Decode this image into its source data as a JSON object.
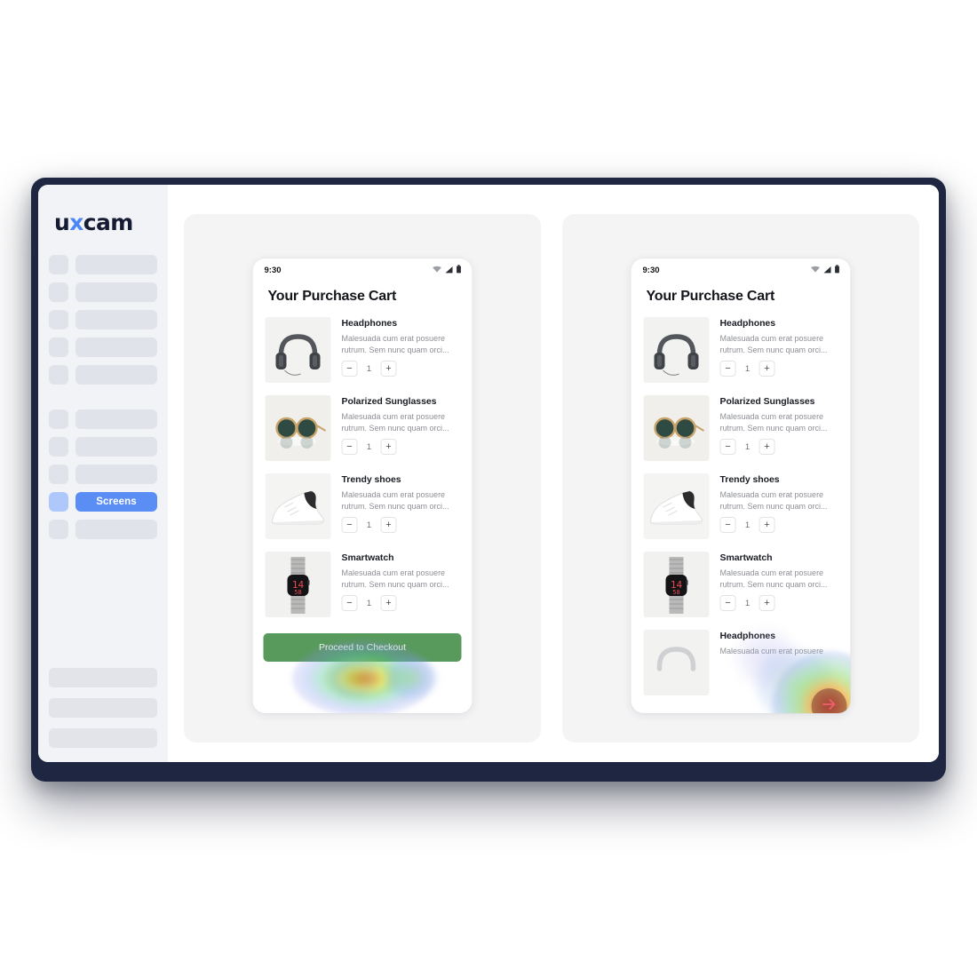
{
  "brand": {
    "name_part1": "u",
    "name_x": "x",
    "name_part2": "cam"
  },
  "sidebar": {
    "group1": [
      {
        "label": ""
      },
      {
        "label": ""
      },
      {
        "label": ""
      },
      {
        "label": ""
      },
      {
        "label": ""
      }
    ],
    "group2": [
      {
        "label": "",
        "active": false
      },
      {
        "label": "",
        "active": false
      },
      {
        "label": "",
        "active": false
      },
      {
        "label": "Screens",
        "active": true
      },
      {
        "label": "",
        "active": false
      }
    ],
    "bottom": [
      {
        "label": ""
      },
      {
        "label": ""
      },
      {
        "label": ""
      }
    ],
    "active_color": "#5b8ef5",
    "active_icon_color": "#aec8fb"
  },
  "phone": {
    "status": {
      "time": "9:30",
      "wifi_icon": "wifi-icon",
      "signal_icon": "signal-icon",
      "battery_icon": "battery-icon"
    },
    "title": "Your Purchase Cart",
    "items": [
      {
        "name": "Headphones",
        "desc": "Malesuada cum erat posuere rutrum. Sem nunc quam orci...",
        "qty": "1",
        "minus": "−",
        "plus": "+",
        "image": "headphones-image"
      },
      {
        "name": "Polarized Sunglasses",
        "desc": "Malesuada cum erat posuere rutrum. Sem nunc quam orci...",
        "qty": "1",
        "minus": "−",
        "plus": "+",
        "image": "sunglasses-image"
      },
      {
        "name": "Trendy shoes",
        "desc": "Malesuada cum erat posuere rutrum. Sem nunc quam orci...",
        "qty": "1",
        "minus": "−",
        "plus": "+",
        "image": "sneaker-image"
      },
      {
        "name": "Smartwatch",
        "desc": "Malesuada cum erat posuere rutrum. Sem nunc quam orci...",
        "qty": "1",
        "minus": "−",
        "plus": "+",
        "image": "smartwatch-image"
      }
    ],
    "extra_item": {
      "name": "Headphones",
      "desc": "Malesuada cum erat posuere"
    },
    "cta_label": "Proceed to Checkout",
    "cta_color": "#589a5b"
  },
  "heatmap": {
    "hot_color": "#ff7800",
    "warm_color": "#e2de28",
    "mid_color": "#78d25a",
    "cool_color": "#8c96e6",
    "arrow_icon": "arrow-right-icon",
    "arrow_color": "#ef5f6e"
  },
  "window": {
    "frame_color": "#1e2642",
    "panel_bg": "#f4f4f5",
    "sidebar_bg": "#f2f3f6"
  }
}
